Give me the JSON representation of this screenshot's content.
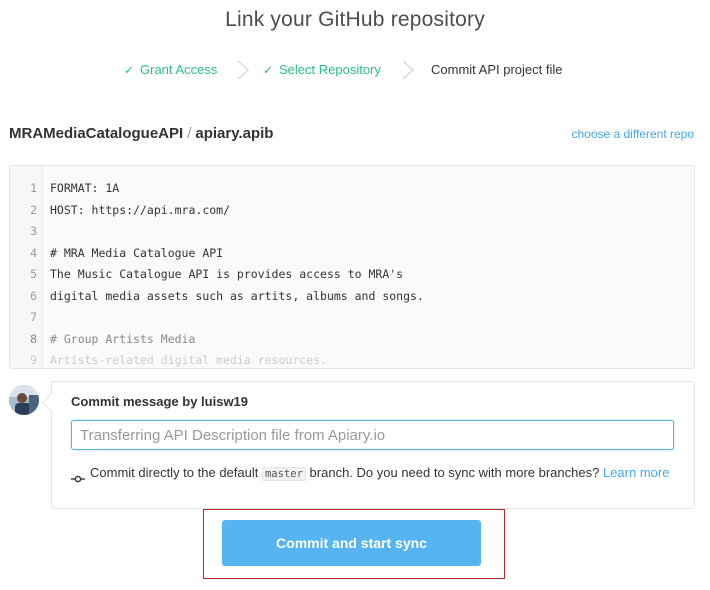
{
  "page_title": "Link your GitHub repository",
  "steps": [
    {
      "label": "Grant Access",
      "status": "done",
      "icon": "check-icon"
    },
    {
      "label": "Select Repository",
      "status": "done",
      "icon": "check-icon"
    },
    {
      "label": "Commit API project file",
      "status": "current"
    }
  ],
  "repo": {
    "name": "MRAMediaCatalogueAPI",
    "separator": "/",
    "file": "apiary.apib",
    "change_link": "choose a different repo"
  },
  "editor": {
    "lines": [
      {
        "n": "1",
        "text": "FORMAT: 1A"
      },
      {
        "n": "2",
        "text": "HOST: https://api.mra.com/"
      },
      {
        "n": "3",
        "text": ""
      },
      {
        "n": "4",
        "text": "# MRA Media Catalogue API"
      },
      {
        "n": "5",
        "text": "The Music Catalogue API is provides access to MRA's"
      },
      {
        "n": "6",
        "text": "digital media assets such as artits, albums and songs."
      },
      {
        "n": "7",
        "text": ""
      },
      {
        "n": "8",
        "text": "# Group Artists Media"
      },
      {
        "n": "9",
        "text": "Artists-related digital media resources."
      }
    ]
  },
  "commit": {
    "label": "Commit message by luisw19",
    "input_placeholder": "Transferring API Description file from Apiary.io",
    "input_value": "",
    "branch_note_prefix": "Commit directly to the default",
    "branch_name": "master",
    "branch_note_suffix": "branch. Do you need to sync with more branches?",
    "learn_more": "Learn more"
  },
  "action": {
    "commit_button": "Commit and start sync"
  },
  "colors": {
    "accent": "#56b4f2",
    "link": "#45a8e8",
    "done": "#2bbf85",
    "highlight_frame": "#b22a2a"
  }
}
